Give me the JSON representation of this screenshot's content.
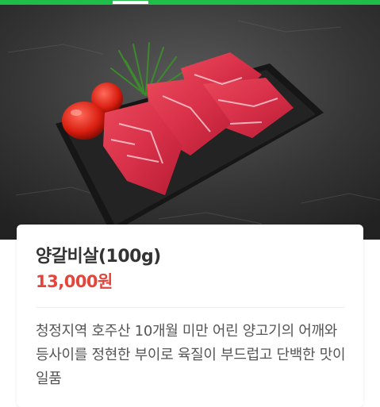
{
  "header": {
    "accent_color": "#1fbd4a"
  },
  "hero": {
    "image": "meat-platter-image"
  },
  "product": {
    "name": "양갈비살(100g)",
    "price": "13,000원",
    "price_color": "#e4453b",
    "description": "청정지역 호주산 10개월 미만 어린 양고기의 어깨와 등사이를 정현한 부이로 육질이 부드럽고 단백한 맛이 일품"
  }
}
